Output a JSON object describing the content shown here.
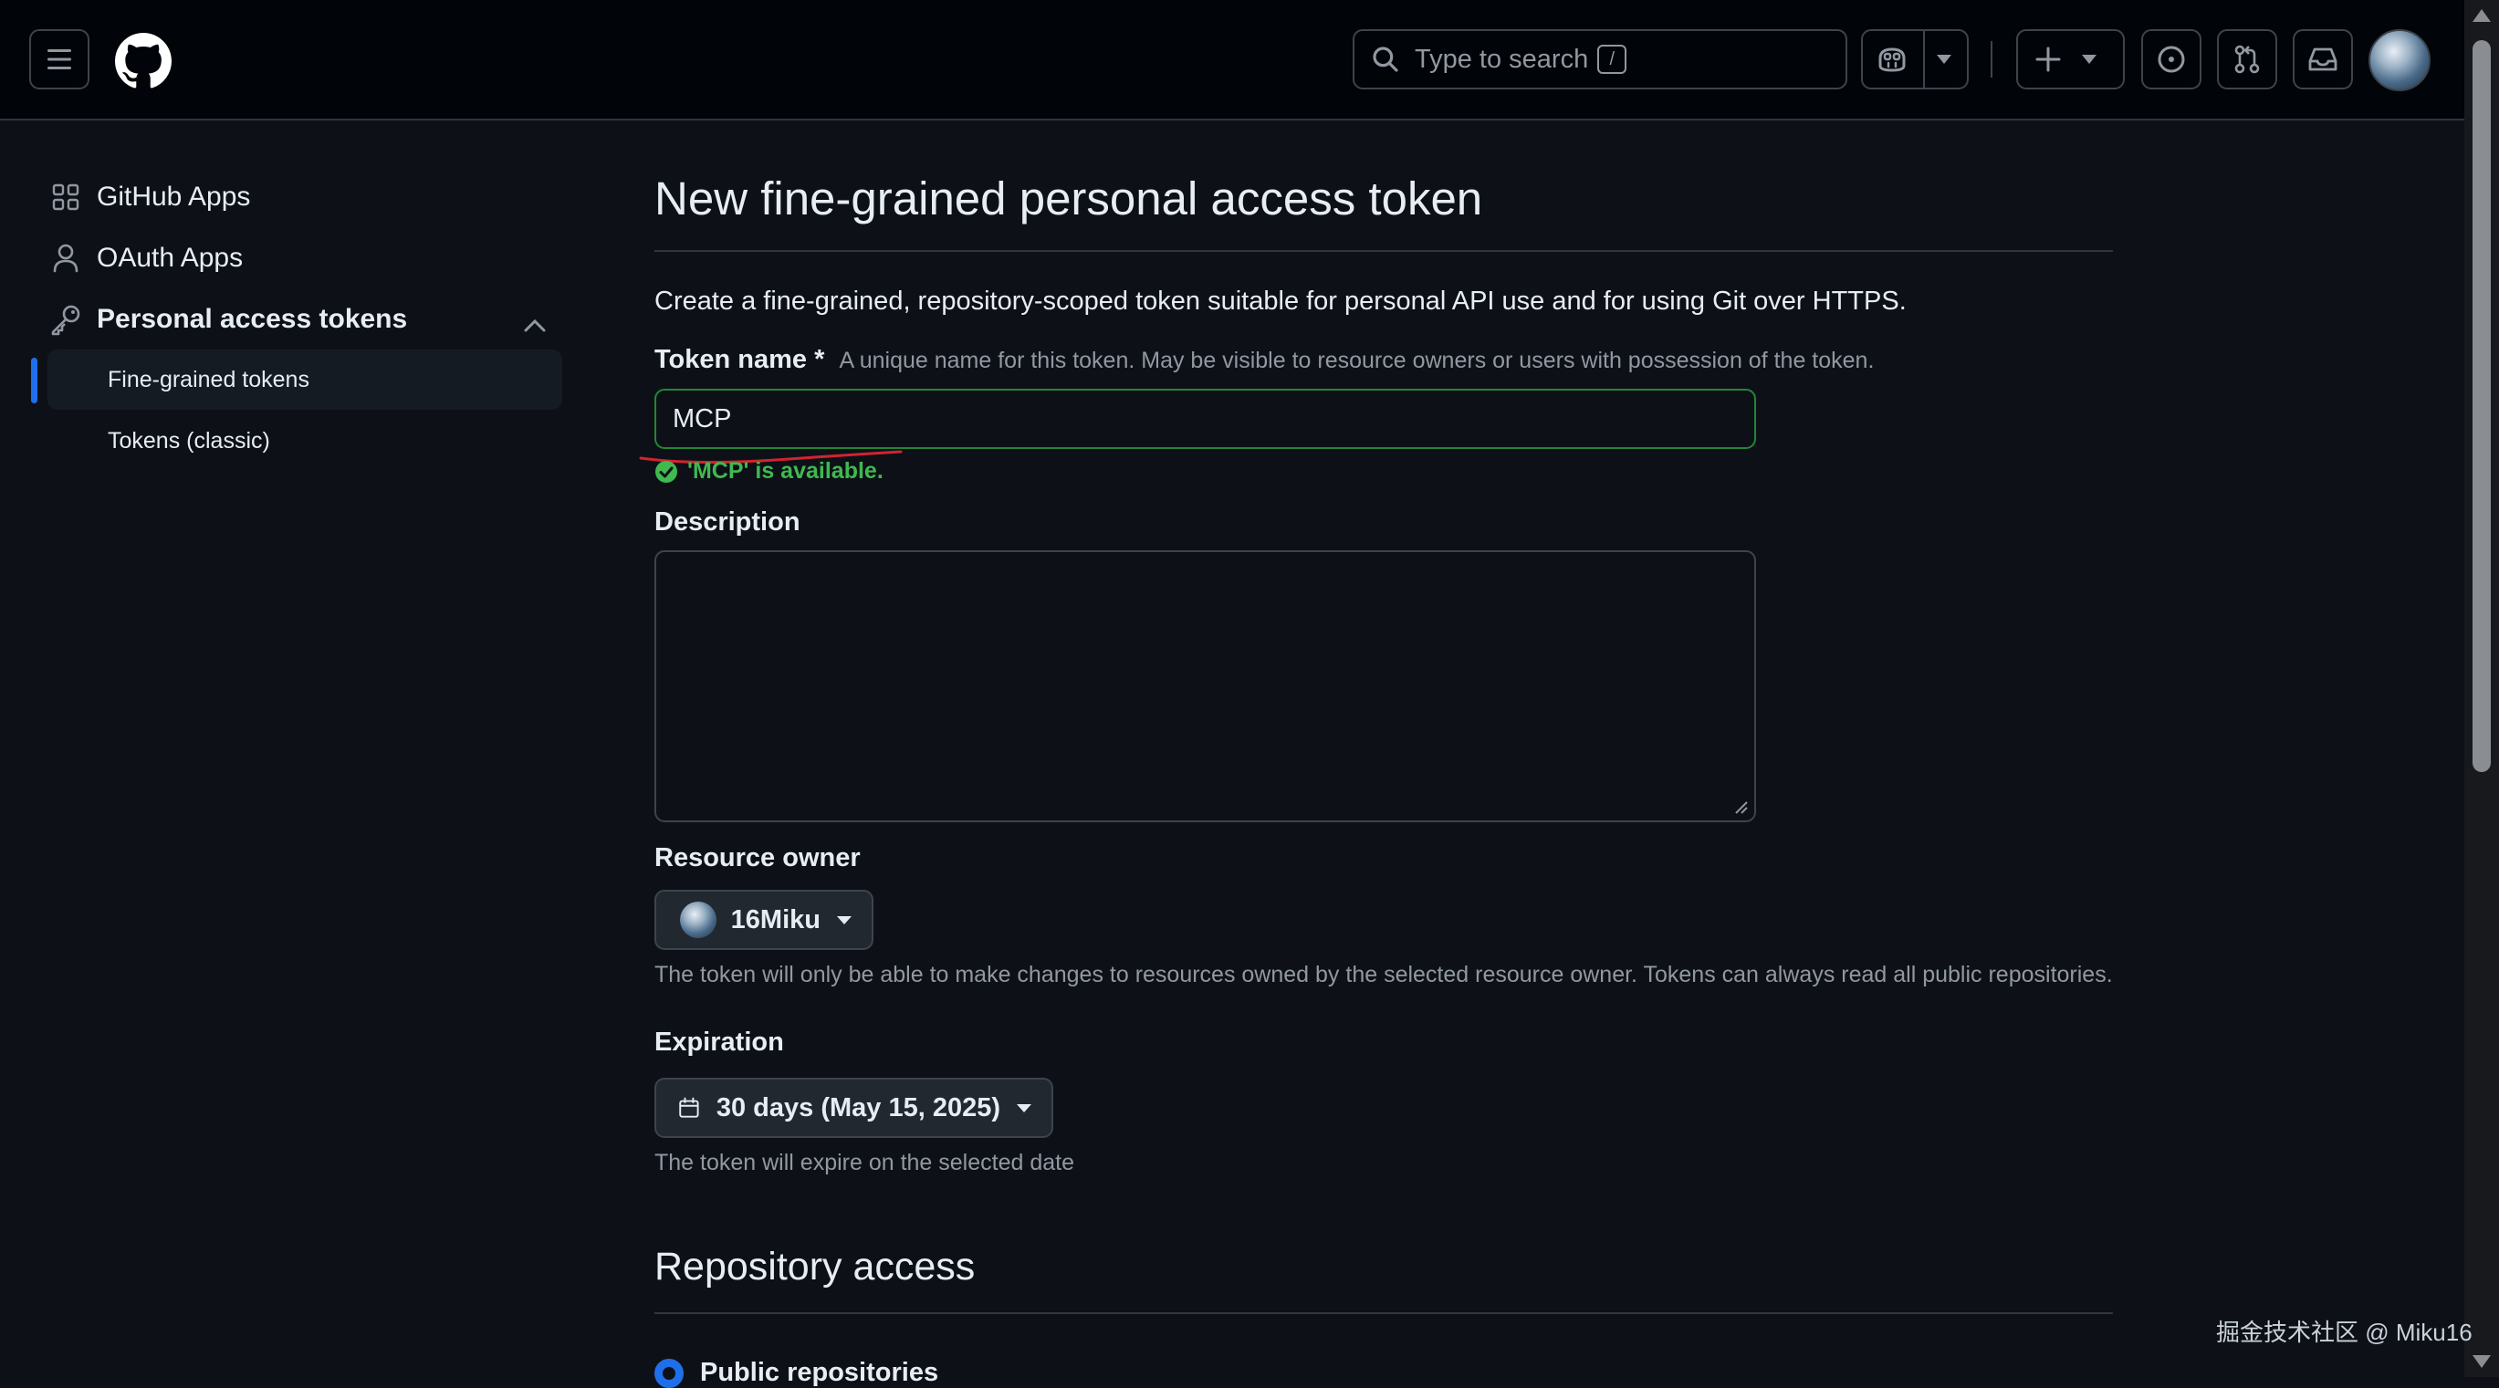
{
  "header": {
    "search_placeholder": "Type to search",
    "search_shortcut": "/"
  },
  "sidebar": {
    "items": [
      {
        "label": "GitHub Apps",
        "icon": "apps-grid-icon"
      },
      {
        "label": "OAuth Apps",
        "icon": "person-icon"
      },
      {
        "label": "Personal access tokens",
        "icon": "key-icon"
      }
    ],
    "subitems": [
      {
        "label": "Fine-grained tokens",
        "active": true
      },
      {
        "label": "Tokens (classic)",
        "active": false
      }
    ]
  },
  "main": {
    "title": "New fine-grained personal access token",
    "intro": "Create a fine-grained, repository-scoped token suitable for personal API use and for using Git over HTTPS.",
    "token_name": {
      "label": "Token name",
      "required_mark": "*",
      "hint": "A unique name for this token. May be visible to resource owners or users with possession of the token.",
      "value": "MCP",
      "validation": "'MCP' is available."
    },
    "description": {
      "label": "Description",
      "value": ""
    },
    "resource_owner": {
      "label": "Resource owner",
      "selected": "16Miku",
      "note": "The token will only be able to make changes to resources owned by the selected resource owner. Tokens can always read all public repositories."
    },
    "expiration": {
      "label": "Expiration",
      "selected": "30 days (May 15, 2025)",
      "note": "The token will expire on the selected date"
    },
    "repository_access": {
      "title": "Repository access",
      "first_option": "Public repositories"
    }
  },
  "watermark": "掘金技术社区 @ Miku16",
  "colors": {
    "background": "#0d1117",
    "header": "#010409",
    "success": "#3fb950",
    "accent": "#1f6feb",
    "annotation": "#d1242f"
  }
}
